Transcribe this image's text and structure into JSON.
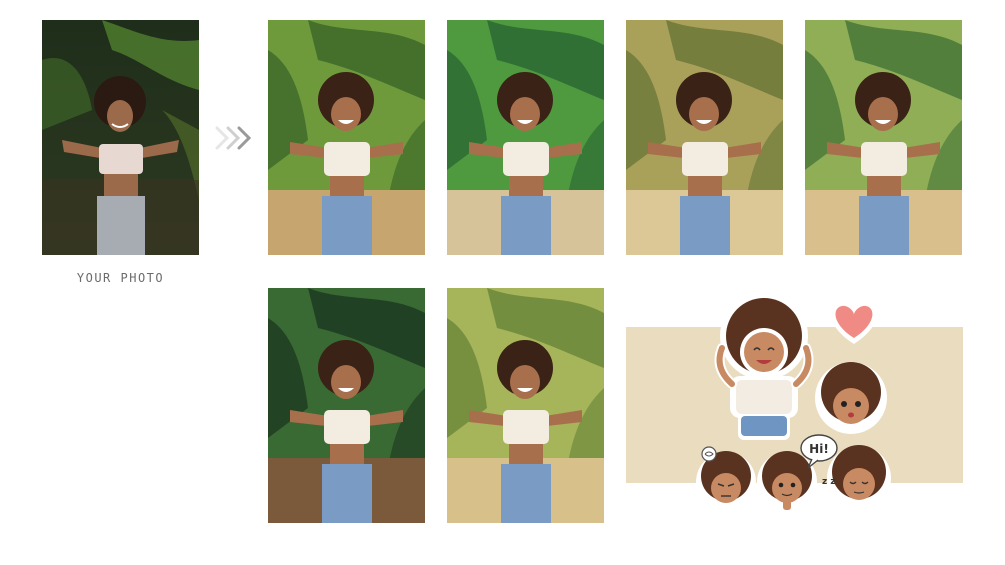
{
  "source": {
    "caption": "YOUR PHOTO",
    "image_name": "original-photo"
  },
  "arrow_icon": "triple-chevron-right-icon",
  "styles": [
    {
      "id": "style-1",
      "palette": [
        "#3f6b2a",
        "#6e9a3c",
        "#c7a56e",
        "#f2e6cf"
      ]
    },
    {
      "id": "style-2",
      "palette": [
        "#2e6b34",
        "#4f9a3f",
        "#d6c39a",
        "#f4ecd9"
      ]
    },
    {
      "id": "style-3",
      "palette": [
        "#6f7a3a",
        "#a9a05a",
        "#dcc797",
        "#efe0bb"
      ]
    },
    {
      "id": "style-4",
      "palette": [
        "#4d7a3a",
        "#8fae55",
        "#d9bf8c",
        "#f3e7cc"
      ]
    },
    {
      "id": "style-5",
      "palette": [
        "#1f3d22",
        "#3a6a33",
        "#7a5a3a",
        "#e8dcc6"
      ]
    },
    {
      "id": "style-6",
      "palette": [
        "#6f8a3c",
        "#a6b45a",
        "#d8c08a",
        "#efe2c2"
      ]
    }
  ],
  "stickers": {
    "bubble_text": "Hi!",
    "zz_text": "z z",
    "bg_color": "#eadcbe",
    "heart_color": "#f08a84"
  }
}
